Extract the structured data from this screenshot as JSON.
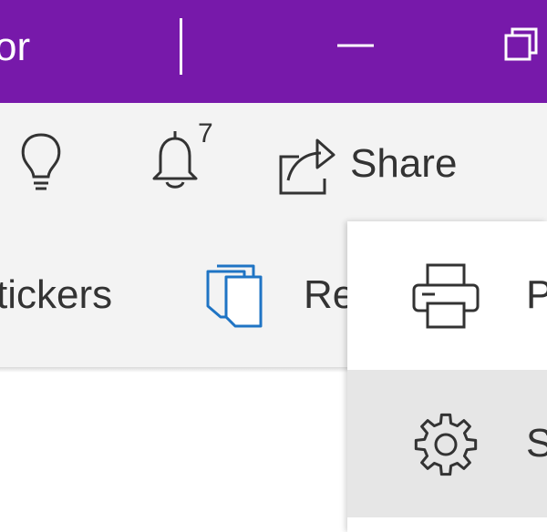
{
  "titlebar": {
    "title_fragment": "or",
    "color": "#7719aa"
  },
  "toolbar": {
    "tips_icon": "lightbulb-icon",
    "notifications_icon": "bell-icon",
    "notifications_count": "7",
    "share_icon": "share-icon",
    "share_label": "Share"
  },
  "ribbon": {
    "stickers_label": "tickers",
    "reading_icon": "books-icon",
    "reading_label": "Re"
  },
  "menu": {
    "items": [
      {
        "icon": "printer-icon",
        "label": "P"
      },
      {
        "icon": "gear-icon",
        "label": "S"
      }
    ]
  },
  "colors": {
    "accent": "#7719aa",
    "toolbar_bg": "#f3f3f3",
    "icon_blue": "#1f74c4",
    "menu_hover": "#e6e6e6"
  }
}
